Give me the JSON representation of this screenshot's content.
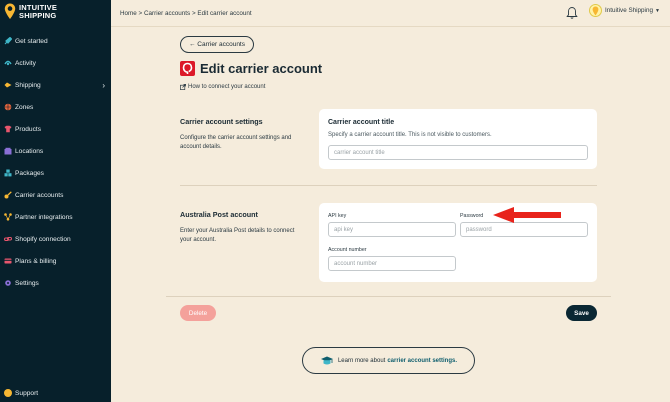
{
  "brand": {
    "line1": "INTUITIVE",
    "line2": "SHIPPING",
    "accent": "#f7b733"
  },
  "sidebar": {
    "items": [
      {
        "label": "Get started",
        "icon": "rocket-icon",
        "color": "#3fb6c8"
      },
      {
        "label": "Activity",
        "icon": "activity-icon",
        "color": "#3fb6c8"
      },
      {
        "label": "Shipping",
        "icon": "shipping-icon",
        "color": "#f7b733",
        "has_chevron": true
      },
      {
        "label": "Zones",
        "icon": "globe-icon",
        "color": "#e8663d"
      },
      {
        "label": "Products",
        "icon": "shirt-icon",
        "color": "#e8566d"
      },
      {
        "label": "Locations",
        "icon": "building-icon",
        "color": "#8a6fd6"
      },
      {
        "label": "Packages",
        "icon": "boxes-icon",
        "color": "#3fb6c8"
      },
      {
        "label": "Carrier accounts",
        "icon": "key-icon",
        "color": "#f7b733"
      },
      {
        "label": "Partner integrations",
        "icon": "network-icon",
        "color": "#f7b733"
      },
      {
        "label": "Shopify connection",
        "icon": "link-icon",
        "color": "#e8566d"
      },
      {
        "label": "Plans & billing",
        "icon": "card-icon",
        "color": "#e8566d"
      },
      {
        "label": "Settings",
        "icon": "gear-icon",
        "color": "#8a6fd6"
      }
    ],
    "support": "Support"
  },
  "topbar": {
    "crumb_home": "Home",
    "crumb_sep": ">",
    "crumb_carrier": "Carrier accounts",
    "crumb_current": "Edit carrier account",
    "user_name": "Intuitive Shipping"
  },
  "main": {
    "back_label": "← Carrier accounts",
    "title": "Edit carrier account",
    "howto": "How to connect your account",
    "settings_section": {
      "title": "Carrier account settings",
      "desc": "Configure the carrier account settings and account details."
    },
    "title_card": {
      "title": "Carrier account title",
      "sub": "Specify a carrier account title. This is not visible to customers.",
      "placeholder": "carrier account title"
    },
    "ap_section": {
      "title": "Australia Post account",
      "desc": "Enter your Australia Post details to connect your account."
    },
    "ap_card": {
      "api_label": "API key",
      "api_placeholder": "api key",
      "password_label": "Password",
      "password_placeholder": "password",
      "account_label": "Account number",
      "account_placeholder": "account number"
    },
    "delete_label": "Delete",
    "save_label": "Save",
    "learn_prefix": "Learn more about",
    "learn_link": "carrier account settings."
  },
  "colors": {
    "sidebar_bg": "#07202b",
    "page_bg": "#f5ecdc",
    "annotation_arrow": "#e8231b",
    "danger": "#f4a19b",
    "primary": "#0a2733"
  }
}
